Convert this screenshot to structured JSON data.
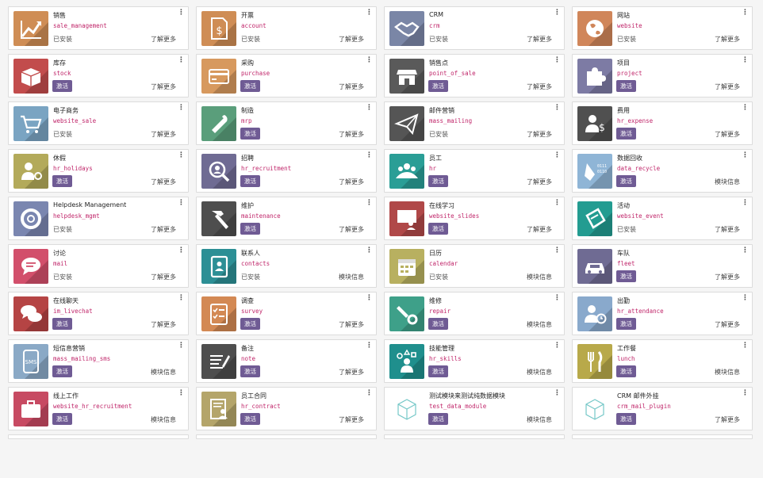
{
  "labels": {
    "installed": "已安装",
    "activate": "激活",
    "more": "了解更多",
    "module_info": "模块信息"
  },
  "apps": [
    {
      "name": "销售",
      "tech": "sale_management",
      "state": "installed",
      "link": "more",
      "icon": "chart-up-icon",
      "color": "#cf8d55"
    },
    {
      "name": "开票",
      "tech": "account",
      "state": "installed",
      "link": "more",
      "icon": "invoice-dollar-icon",
      "color": "#cf8d55"
    },
    {
      "name": "CRM",
      "tech": "crm",
      "state": "installed",
      "link": "more",
      "icon": "handshake-icon",
      "color": "#7a86a6"
    },
    {
      "name": "网站",
      "tech": "website",
      "state": "installed",
      "link": "more",
      "icon": "globe-icon",
      "color": "#d0865a"
    },
    {
      "name": "库存",
      "tech": "stock",
      "state": "activate",
      "link": "more",
      "icon": "box-icon",
      "color": "#c24c4c"
    },
    {
      "name": "采购",
      "tech": "purchase",
      "state": "activate",
      "link": "more",
      "icon": "credit-card-icon",
      "color": "#d7995e"
    },
    {
      "name": "销售点",
      "tech": "point_of_sale",
      "state": "activate",
      "link": "more",
      "icon": "shop-icon",
      "color": "#5a5a5a"
    },
    {
      "name": "项目",
      "tech": "project",
      "state": "activate",
      "link": "more",
      "icon": "puzzle-icon",
      "color": "#7d7ba4"
    },
    {
      "name": "电子商务",
      "tech": "website_sale",
      "state": "installed",
      "link": "more",
      "icon": "cart-icon",
      "color": "#7aa4c2"
    },
    {
      "name": "制造",
      "tech": "mrp",
      "state": "activate",
      "link": "more",
      "icon": "wrench-icon",
      "color": "#5a9e7b"
    },
    {
      "name": "邮件营销",
      "tech": "mass_mailing",
      "state": "installed",
      "link": "more",
      "icon": "paper-plane-icon",
      "color": "#555555"
    },
    {
      "name": "费用",
      "tech": "hr_expense",
      "state": "activate",
      "link": "more",
      "icon": "user-dollar-icon",
      "color": "#505050"
    },
    {
      "name": "休假",
      "tech": "hr_holidays",
      "state": "activate",
      "link": "more",
      "icon": "user-sun-icon",
      "color": "#b3aa5a"
    },
    {
      "name": "招聘",
      "tech": "hr_recruitment",
      "state": "activate",
      "link": "more",
      "icon": "magnifier-user-icon",
      "color": "#6f6b93"
    },
    {
      "name": "员工",
      "tech": "hr",
      "state": "activate",
      "link": "more",
      "icon": "users-icon",
      "color": "#2a9e96"
    },
    {
      "name": "数据回收",
      "tech": "data_recycle",
      "state": "activate",
      "link": "info",
      "icon": "broom-binary-icon",
      "color": "#8fb5d6"
    },
    {
      "name": "Helpdesk Management",
      "tech": "helpdesk_mgmt",
      "state": "installed",
      "link": "more",
      "icon": "lifebuoy-icon",
      "color": "#7a86b0"
    },
    {
      "name": "维护",
      "tech": "maintenance",
      "state": "activate",
      "link": "more",
      "icon": "hammer-icon",
      "color": "#4e4e4e"
    },
    {
      "name": "在线学习",
      "tech": "website_slides",
      "state": "activate",
      "link": "more",
      "icon": "presentation-icon",
      "color": "#b04848"
    },
    {
      "name": "活动",
      "tech": "website_event",
      "state": "installed",
      "link": "more",
      "icon": "ticket-icon",
      "color": "#239c91"
    },
    {
      "name": "讨论",
      "tech": "mail",
      "state": "installed",
      "link": "more",
      "icon": "chat-bubble-icon",
      "color": "#d24f6b"
    },
    {
      "name": "联系人",
      "tech": "contacts",
      "state": "installed",
      "link": "info",
      "icon": "address-book-icon",
      "color": "#2c8f95"
    },
    {
      "name": "日历",
      "tech": "calendar",
      "state": "installed",
      "link": "info",
      "icon": "calendar-icon",
      "color": "#b8b060"
    },
    {
      "name": "车队",
      "tech": "fleet",
      "state": "activate",
      "link": "more",
      "icon": "car-icon",
      "color": "#6f6b93"
    },
    {
      "name": "在线聊天",
      "tech": "im_livechat",
      "state": "activate",
      "link": "more",
      "icon": "chat-bubbles-icon",
      "color": "#b54444"
    },
    {
      "name": "调查",
      "tech": "survey",
      "state": "activate",
      "link": "more",
      "icon": "checklist-icon",
      "color": "#d38954"
    },
    {
      "name": "维修",
      "tech": "repair",
      "state": "activate",
      "link": "info",
      "icon": "wrench-gear-icon",
      "color": "#3ea089"
    },
    {
      "name": "出勤",
      "tech": "hr_attendance",
      "state": "activate",
      "link": "more",
      "icon": "user-clock-icon",
      "color": "#89a9cc"
    },
    {
      "name": "短信息营销",
      "tech": "mass_mailing_sms",
      "state": "activate",
      "link": "info",
      "icon": "sms-phone-icon",
      "color": "#8aa9c6"
    },
    {
      "name": "备注",
      "tech": "note",
      "state": "activate",
      "link": "more",
      "icon": "note-pen-icon",
      "color": "#4e4e4e"
    },
    {
      "name": "技能管理",
      "tech": "hr_skills",
      "state": "activate",
      "link": "info",
      "icon": "person-shapes-icon",
      "color": "#1f8f8d"
    },
    {
      "name": "工作餐",
      "tech": "lunch",
      "state": "activate",
      "link": "info",
      "icon": "cutlery-icon",
      "color": "#b8a94a"
    },
    {
      "name": "线上工作",
      "tech": "website_hr_recruitment",
      "state": "activate",
      "link": "info",
      "icon": "briefcase-icon",
      "color": "#c74a62"
    },
    {
      "name": "员工合同",
      "tech": "hr_contract",
      "state": "activate",
      "link": "more",
      "icon": "contract-user-icon",
      "color": "#b4a56a"
    },
    {
      "name": "测试模块来测试纯数据模块",
      "tech": "test_data_module",
      "state": "activate",
      "link": "info",
      "icon": "cube-icon",
      "color": ""
    },
    {
      "name": "CRM 邮件外挂",
      "tech": "crm_mail_plugin",
      "state": "activate",
      "link": "more",
      "icon": "cube-icon",
      "color": ""
    }
  ]
}
